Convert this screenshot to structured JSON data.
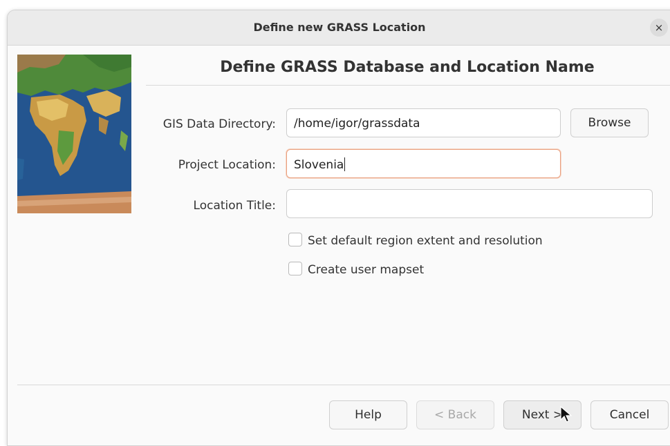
{
  "window": {
    "title": "Define new GRASS Location",
    "close_glyph": "×"
  },
  "page": {
    "heading": "Define GRASS Database and Location Name"
  },
  "form": {
    "gis_dir_label": "GIS Data Directory:",
    "gis_dir_value": "/home/igor/grassdata",
    "browse_label": "Browse",
    "location_label": "Project Location:",
    "location_value": "Slovenia",
    "title_label": "Location Title:",
    "title_value": ""
  },
  "options": {
    "region_label": "Set default region extent and resolution",
    "region_checked": false,
    "mapset_label": "Create user mapset",
    "mapset_checked": false
  },
  "buttons": {
    "help": "Help",
    "back": "< Back",
    "next": "Next >",
    "cancel": "Cancel"
  },
  "colors": {
    "focus_border": "#e9a07f",
    "ocean": "#1e4e86"
  },
  "icons": {
    "close": "close-icon",
    "cursor": "mouse-pointer-icon",
    "map": "world-map-image"
  }
}
